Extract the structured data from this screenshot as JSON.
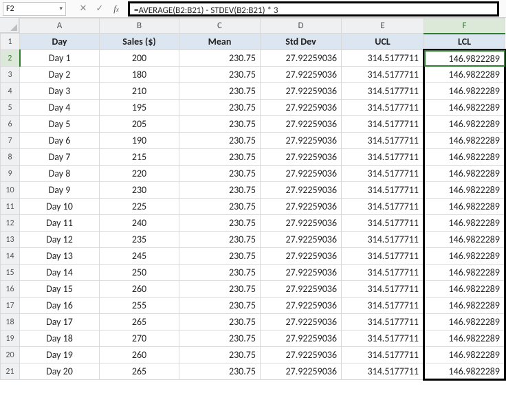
{
  "name_box": {
    "value": "F2"
  },
  "formula": "=AVERAGE(B2:B21) - STDEV(B2:B21) * 3",
  "columns": [
    "A",
    "B",
    "C",
    "D",
    "E",
    "F"
  ],
  "selected_column": "F",
  "active_cell": {
    "row": 2,
    "col": "F"
  },
  "sheet_header": {
    "A": "Day",
    "B": "Sales ($)",
    "C": "Mean",
    "D": "Std Dev",
    "E": "UCL",
    "F": "LCL"
  },
  "rows": [
    {
      "n": 2,
      "A": "Day 1",
      "B": "200",
      "C": "230.75",
      "D": "27.92259036",
      "E": "314.5177711",
      "F": "146.9822289"
    },
    {
      "n": 3,
      "A": "Day 2",
      "B": "180",
      "C": "230.75",
      "D": "27.92259036",
      "E": "314.5177711",
      "F": "146.9822289"
    },
    {
      "n": 4,
      "A": "Day 3",
      "B": "210",
      "C": "230.75",
      "D": "27.92259036",
      "E": "314.5177711",
      "F": "146.9822289"
    },
    {
      "n": 5,
      "A": "Day 4",
      "B": "195",
      "C": "230.75",
      "D": "27.92259036",
      "E": "314.5177711",
      "F": "146.9822289"
    },
    {
      "n": 6,
      "A": "Day 5",
      "B": "205",
      "C": "230.75",
      "D": "27.92259036",
      "E": "314.5177711",
      "F": "146.9822289"
    },
    {
      "n": 7,
      "A": "Day 6",
      "B": "190",
      "C": "230.75",
      "D": "27.92259036",
      "E": "314.5177711",
      "F": "146.9822289"
    },
    {
      "n": 8,
      "A": "Day 7",
      "B": "215",
      "C": "230.75",
      "D": "27.92259036",
      "E": "314.5177711",
      "F": "146.9822289"
    },
    {
      "n": 9,
      "A": "Day 8",
      "B": "220",
      "C": "230.75",
      "D": "27.92259036",
      "E": "314.5177711",
      "F": "146.9822289"
    },
    {
      "n": 10,
      "A": "Day 9",
      "B": "230",
      "C": "230.75",
      "D": "27.92259036",
      "E": "314.5177711",
      "F": "146.9822289"
    },
    {
      "n": 11,
      "A": "Day 10",
      "B": "225",
      "C": "230.75",
      "D": "27.92259036",
      "E": "314.5177711",
      "F": "146.9822289"
    },
    {
      "n": 12,
      "A": "Day 11",
      "B": "240",
      "C": "230.75",
      "D": "27.92259036",
      "E": "314.5177711",
      "F": "146.9822289"
    },
    {
      "n": 13,
      "A": "Day 12",
      "B": "235",
      "C": "230.75",
      "D": "27.92259036",
      "E": "314.5177711",
      "F": "146.9822289"
    },
    {
      "n": 14,
      "A": "Day 13",
      "B": "245",
      "C": "230.75",
      "D": "27.92259036",
      "E": "314.5177711",
      "F": "146.9822289"
    },
    {
      "n": 15,
      "A": "Day 14",
      "B": "250",
      "C": "230.75",
      "D": "27.92259036",
      "E": "314.5177711",
      "F": "146.9822289"
    },
    {
      "n": 16,
      "A": "Day 15",
      "B": "260",
      "C": "230.75",
      "D": "27.92259036",
      "E": "314.5177711",
      "F": "146.9822289"
    },
    {
      "n": 17,
      "A": "Day 16",
      "B": "255",
      "C": "230.75",
      "D": "27.92259036",
      "E": "314.5177711",
      "F": "146.9822289"
    },
    {
      "n": 18,
      "A": "Day 17",
      "B": "265",
      "C": "230.75",
      "D": "27.92259036",
      "E": "314.5177711",
      "F": "146.9822289"
    },
    {
      "n": 19,
      "A": "Day 18",
      "B": "270",
      "C": "230.75",
      "D": "27.92259036",
      "E": "314.5177711",
      "F": "146.9822289"
    },
    {
      "n": 20,
      "A": "Day 19",
      "B": "260",
      "C": "230.75",
      "D": "27.92259036",
      "E": "314.5177711",
      "F": "146.9822289"
    },
    {
      "n": 21,
      "A": "Day 20",
      "B": "265",
      "C": "230.75",
      "D": "27.92259036",
      "E": "314.5177711",
      "F": "146.9822289"
    }
  ],
  "highlight_col": "F",
  "highlight_rows": {
    "from": 2,
    "to": 21
  },
  "chart_data": {
    "type": "table",
    "title": "Control chart statistics",
    "columns": [
      "Day",
      "Sales ($)",
      "Mean",
      "Std Dev",
      "UCL",
      "LCL"
    ],
    "categories": [
      "Day 1",
      "Day 2",
      "Day 3",
      "Day 4",
      "Day 5",
      "Day 6",
      "Day 7",
      "Day 8",
      "Day 9",
      "Day 10",
      "Day 11",
      "Day 12",
      "Day 13",
      "Day 14",
      "Day 15",
      "Day 16",
      "Day 17",
      "Day 18",
      "Day 19",
      "Day 20"
    ],
    "series": [
      {
        "name": "Sales ($)",
        "values": [
          200,
          180,
          210,
          195,
          205,
          190,
          215,
          220,
          230,
          225,
          240,
          235,
          245,
          250,
          260,
          255,
          265,
          270,
          260,
          265
        ]
      },
      {
        "name": "Mean",
        "values": [
          230.75,
          230.75,
          230.75,
          230.75,
          230.75,
          230.75,
          230.75,
          230.75,
          230.75,
          230.75,
          230.75,
          230.75,
          230.75,
          230.75,
          230.75,
          230.75,
          230.75,
          230.75,
          230.75,
          230.75
        ]
      },
      {
        "name": "Std Dev",
        "values": [
          27.92259036,
          27.92259036,
          27.92259036,
          27.92259036,
          27.92259036,
          27.92259036,
          27.92259036,
          27.92259036,
          27.92259036,
          27.92259036,
          27.92259036,
          27.92259036,
          27.92259036,
          27.92259036,
          27.92259036,
          27.92259036,
          27.92259036,
          27.92259036,
          27.92259036,
          27.92259036
        ]
      },
      {
        "name": "UCL",
        "values": [
          314.5177711,
          314.5177711,
          314.5177711,
          314.5177711,
          314.5177711,
          314.5177711,
          314.5177711,
          314.5177711,
          314.5177711,
          314.5177711,
          314.5177711,
          314.5177711,
          314.5177711,
          314.5177711,
          314.5177711,
          314.5177711,
          314.5177711,
          314.5177711,
          314.5177711,
          314.5177711
        ]
      },
      {
        "name": "LCL",
        "values": [
          146.9822289,
          146.9822289,
          146.9822289,
          146.9822289,
          146.9822289,
          146.9822289,
          146.9822289,
          146.9822289,
          146.9822289,
          146.9822289,
          146.9822289,
          146.9822289,
          146.9822289,
          146.9822289,
          146.9822289,
          146.9822289,
          146.9822289,
          146.9822289,
          146.9822289,
          146.9822289
        ]
      }
    ]
  }
}
